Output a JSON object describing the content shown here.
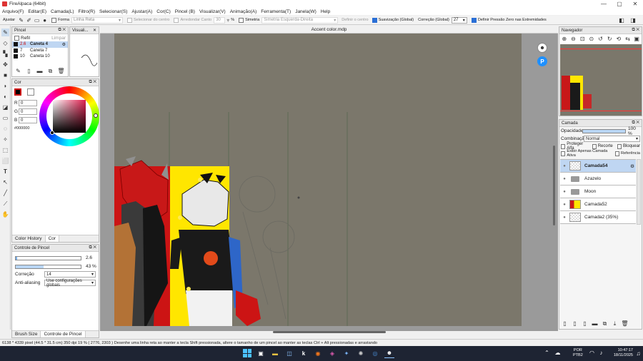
{
  "title_bar": {
    "app_title": "FireAlpaca (64bit)"
  },
  "menu": [
    "Arquivo(F)",
    "Editar(E)",
    "Camada(L)",
    "Filtro(R)",
    "Selecionar(S)",
    "Ajustar(A)",
    "Cor(C)",
    "Pincel (B)",
    "Visualizar(V)",
    "Animação(A)",
    "Ferramenta(T)",
    "Janela(W)",
    "Help"
  ],
  "toolbar": {
    "adjust": "Ajustar",
    "forma": "Forma",
    "linha_reta": "Linha Reta",
    "selecionar_centro": "Selecionar do centro",
    "arredondar": "Arredondar Canto",
    "arredondar_value": "30",
    "percent": "%",
    "simetria": "Simetria",
    "simetria_value": "Simetria Esquerda-Direita",
    "definir_centro": "Definir o centro",
    "suavizacao": "Suavização (Global)",
    "correcao": "Correção (Global)",
    "correcao_value": "27",
    "pressao": "Definir Pressão Zero nas Extremidades"
  },
  "pincel_panel": {
    "title": "Pincel",
    "refil": "Refil",
    "limpar": "Limpar",
    "pens": [
      {
        "size": "2.6",
        "name": "Caneta 4",
        "selected": true
      },
      {
        "size": "7",
        "name": "Caneta 7",
        "selected": false
      },
      {
        "size": "10",
        "name": "Caneta 10",
        "selected": false
      }
    ]
  },
  "visual_panel": {
    "title": "Visuali..."
  },
  "cor_panel": {
    "title": "Cor",
    "r_label": "R",
    "r_value": "0",
    "g_label": "G",
    "g_value": "0",
    "b_label": "B",
    "b_value": "0",
    "hex": "#000000",
    "tabs": [
      "Color History",
      "Cor"
    ]
  },
  "brush_control": {
    "title": "Controle de Pincel",
    "size_value": "2.6",
    "opacity_value": "43 %",
    "opacity_fraction": 0.43,
    "correction_label": "Correção",
    "correction_value": "14",
    "antialias_label": "Anti-aliasing",
    "antialias_value": "Use configurações globais",
    "tabs": [
      "Brush Size",
      "Controle de Pincel"
    ]
  },
  "canvas": {
    "doc_tab": "Accent color.mdp"
  },
  "navigator": {
    "title": "Navegador"
  },
  "camada_panel": {
    "title": "Camada",
    "opacity_label": "Opacidade",
    "opacity_value": "100 %",
    "blend_label": "Combinação",
    "blend_value": "Normal",
    "protect_alpha": "Proteger Alfa",
    "clip": "Recorte",
    "lock": "Bloquear",
    "show_active": "Exibir Apenas Camada Ativa",
    "reference": "Referência",
    "layers": [
      {
        "name": "Camada54",
        "type": "layer",
        "selected": true
      },
      {
        "name": "Azazelo",
        "type": "folder",
        "selected": false
      },
      {
        "name": "Moon",
        "type": "folder",
        "selected": false
      },
      {
        "name": "Camada52",
        "type": "layer",
        "selected": false
      },
      {
        "name": "Camada2 (35%)",
        "type": "layer",
        "selected": false
      }
    ]
  },
  "status_bar": {
    "info": "6138 * 4339 pixel   (44.5 * 31.5 cm)   350 dpi   19 %   ( 2776, 2303 )   Desenhe uma linha reta ao manter a tecla Shift pressionada, altere o tamanho de um pincel ao manter as teclas Ctrl + Alt pressionadas e arrastando"
  },
  "taskbar": {
    "lang_top": "POR",
    "lang_bottom": "PTB2",
    "time": "10:47:17",
    "date": "18/11/2025"
  },
  "colors": {
    "accent": "#2a6fd6",
    "canvas_bg": "#7b776b",
    "workspace": "#9a9a9a"
  }
}
